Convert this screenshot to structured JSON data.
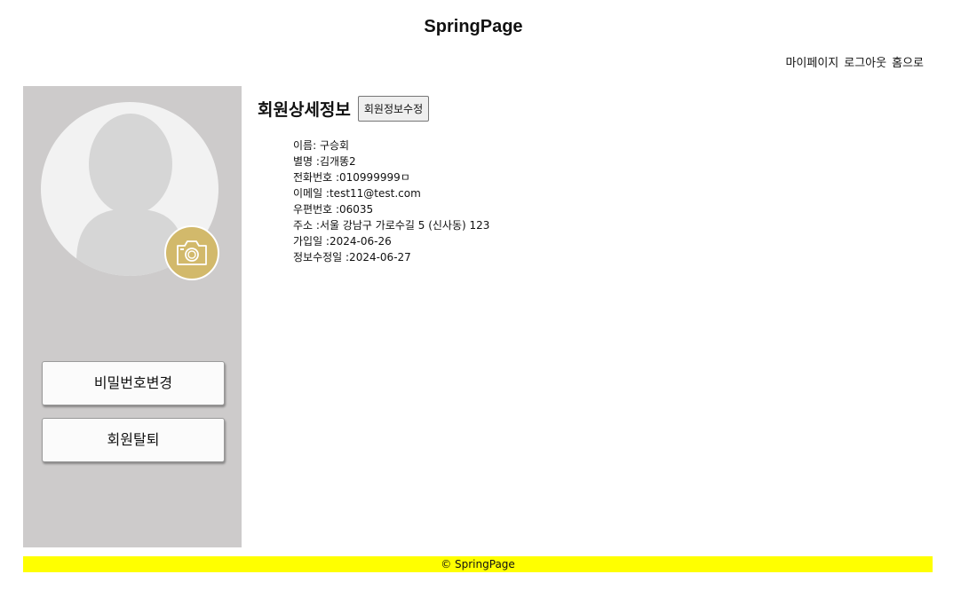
{
  "site": {
    "title": "SpringPage"
  },
  "nav": {
    "mypage": "마이페이지",
    "logout": "로그아웃",
    "home": "홈으로"
  },
  "sidebar": {
    "avatar_icon": "default-user-silhouette",
    "camera_icon": "camera-icon",
    "change_password_label": "비밀번호변경",
    "withdraw_label": "회원탈퇴"
  },
  "main": {
    "title": "회원상세정보",
    "edit_button": "회원정보수정",
    "fields": {
      "name": "이름: 구승회",
      "nickname": "별명 :김개똥2",
      "phone": "전화번호 :010999999ㅁ",
      "email": "이메일 :test11@test.com",
      "zipcode": "우편번호 :06035",
      "address": "주소 :서울 강남구 가로수길 5 (신사동) 123",
      "joined": "가입일 :2024-06-26",
      "modified": "정보수정일 :2024-06-27"
    }
  },
  "footer": {
    "text": "© SpringPage"
  },
  "colors": {
    "sidebar_bg": "#cdcbcb",
    "camera_bg": "#d2b96b",
    "footer_bg": "#ffff00"
  }
}
